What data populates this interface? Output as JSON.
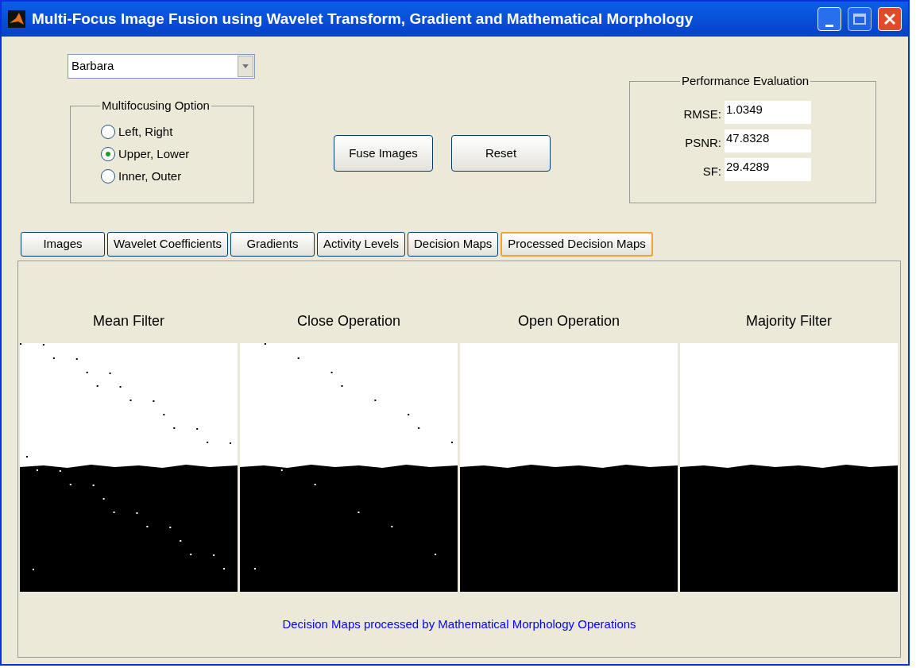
{
  "window": {
    "title": "Multi-Focus Image Fusion using Wavelet Transform, Gradient and Mathematical Morphology"
  },
  "image_select": {
    "value": "Barbara"
  },
  "multifocusing_option": {
    "title": "Multifocusing Option",
    "options": [
      {
        "label": "Left, Right",
        "selected": false
      },
      {
        "label": "Upper, Lower",
        "selected": true
      },
      {
        "label": "Inner, Outer",
        "selected": false
      }
    ]
  },
  "buttons": [
    "Fuse Images",
    "Reset"
  ],
  "performance_evaluation": {
    "title": "Performance Evaluation",
    "metrics": [
      {
        "label": "RMSE:",
        "value": "1.0349"
      },
      {
        "label": "PSNR:",
        "value": "47.8328"
      },
      {
        "label": "SF:",
        "value": "29.4289"
      }
    ]
  },
  "tabs": [
    {
      "label": "Images",
      "selected": false
    },
    {
      "label": "Wavelet Coefficients",
      "selected": false
    },
    {
      "label": "Gradients",
      "selected": false
    },
    {
      "label": "Activity Levels",
      "selected": false
    },
    {
      "label": "Decision Maps",
      "selected": false
    },
    {
      "label": "Processed Decision Maps",
      "selected": true
    }
  ],
  "panel": {
    "images": [
      {
        "title": "Mean Filter"
      },
      {
        "title": "Close Operation"
      },
      {
        "title": "Open Operation"
      },
      {
        "title": "Majority Filter"
      }
    ],
    "caption": "Decision Maps processed by Mathematical Morphology Operations"
  }
}
